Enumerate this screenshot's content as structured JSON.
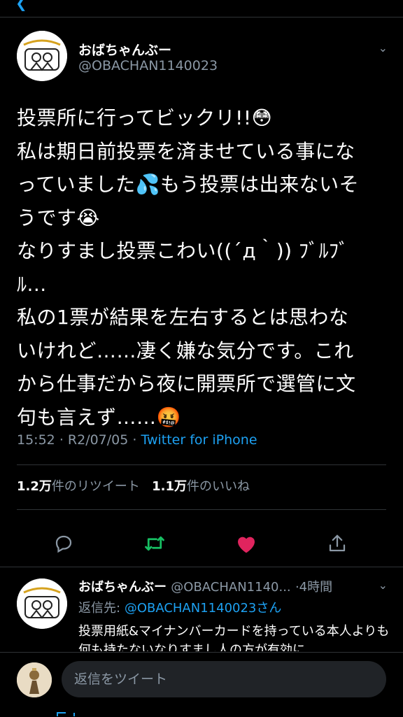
{
  "tweet": {
    "author_name": "おばちゃんぶー",
    "author_handle": "@OBACHAN1140023",
    "text": "投票所に行ってビックリ!!😳\n私は期日前投票を済ませている事にな\nっていました💦もう投票は出来ないそ\nうです😭\nなりすまし投票こわい((´д｀)) ﾌﾞﾙﾌﾞ\nﾙ...\n私の1票が結果を左右するとは思わな\nいけれど……凄く嫌な気分です。これ\nから仕事だから夜に開票所で選管に文\n句も言えず……🤬",
    "time": "15:52",
    "date": "R2/07/05",
    "source": "Twitter for iPhone",
    "retweets_count": "1.2万",
    "retweets_label": "件のリツイート",
    "likes_count": "1.1万",
    "likes_label": "件のいいね"
  },
  "actions": [
    "reply-icon",
    "retweet-icon",
    "like-icon",
    "share-icon"
  ],
  "colors": {
    "accent": "#1da1f2",
    "retweet": "#17bf63",
    "like": "#e0245e",
    "muted": "#8b98a5"
  },
  "reply": {
    "author_name": "おばちゃんぶー",
    "author_handle": "@OBACHAN1140...",
    "time": "4時間",
    "reply_to_label": "返信先:",
    "reply_to_handle": "@OBACHAN1140023さん",
    "text": "投票用紙&マイナンバーカードを持っている本人よりも何も持たないなりすまし人の方が有効に"
  },
  "composer": {
    "placeholder": "返信をツイート"
  }
}
